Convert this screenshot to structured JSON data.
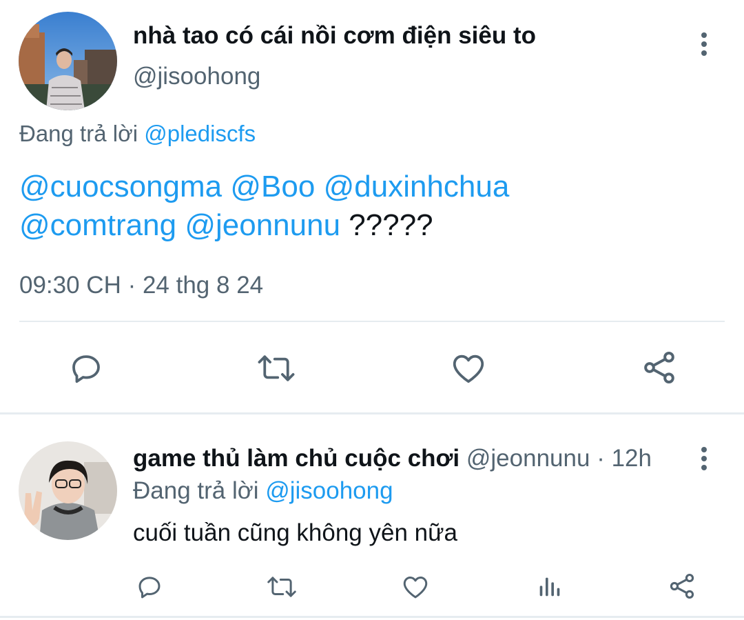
{
  "main_tweet": {
    "display_name": "nhà tao có cái nồi cơm điện siêu to",
    "handle": "@jisoohong",
    "replying_to_prefix": "Đang trả lời",
    "replying_to_handle": "@plediscfs",
    "mentions": [
      "@cuocsongma",
      "@Boo",
      "@duxinhchua",
      "@comtrang",
      "@jeonnunu"
    ],
    "body_suffix": "?????",
    "timestamp": "09:30 CH · 24 thg 8 24",
    "actions": [
      "reply-icon",
      "retweet-icon",
      "like-icon",
      "share-icon"
    ]
  },
  "reply_tweet": {
    "display_name": "game thủ làm chủ cuộc chơi",
    "handle": "@jeonnunu",
    "separator": "·",
    "time_ago": "12h",
    "replying_to_prefix": "Đang trả lời",
    "replying_to_handle": "@jisoohong",
    "body": "cuối tuần cũng không yên nữa",
    "actions": [
      "reply-icon",
      "retweet-icon",
      "like-icon",
      "analytics-icon",
      "share-icon"
    ]
  },
  "colors": {
    "link": "#1d9bf0",
    "muted": "#536471",
    "text": "#0f1419",
    "divider": "#e6ecf0"
  }
}
